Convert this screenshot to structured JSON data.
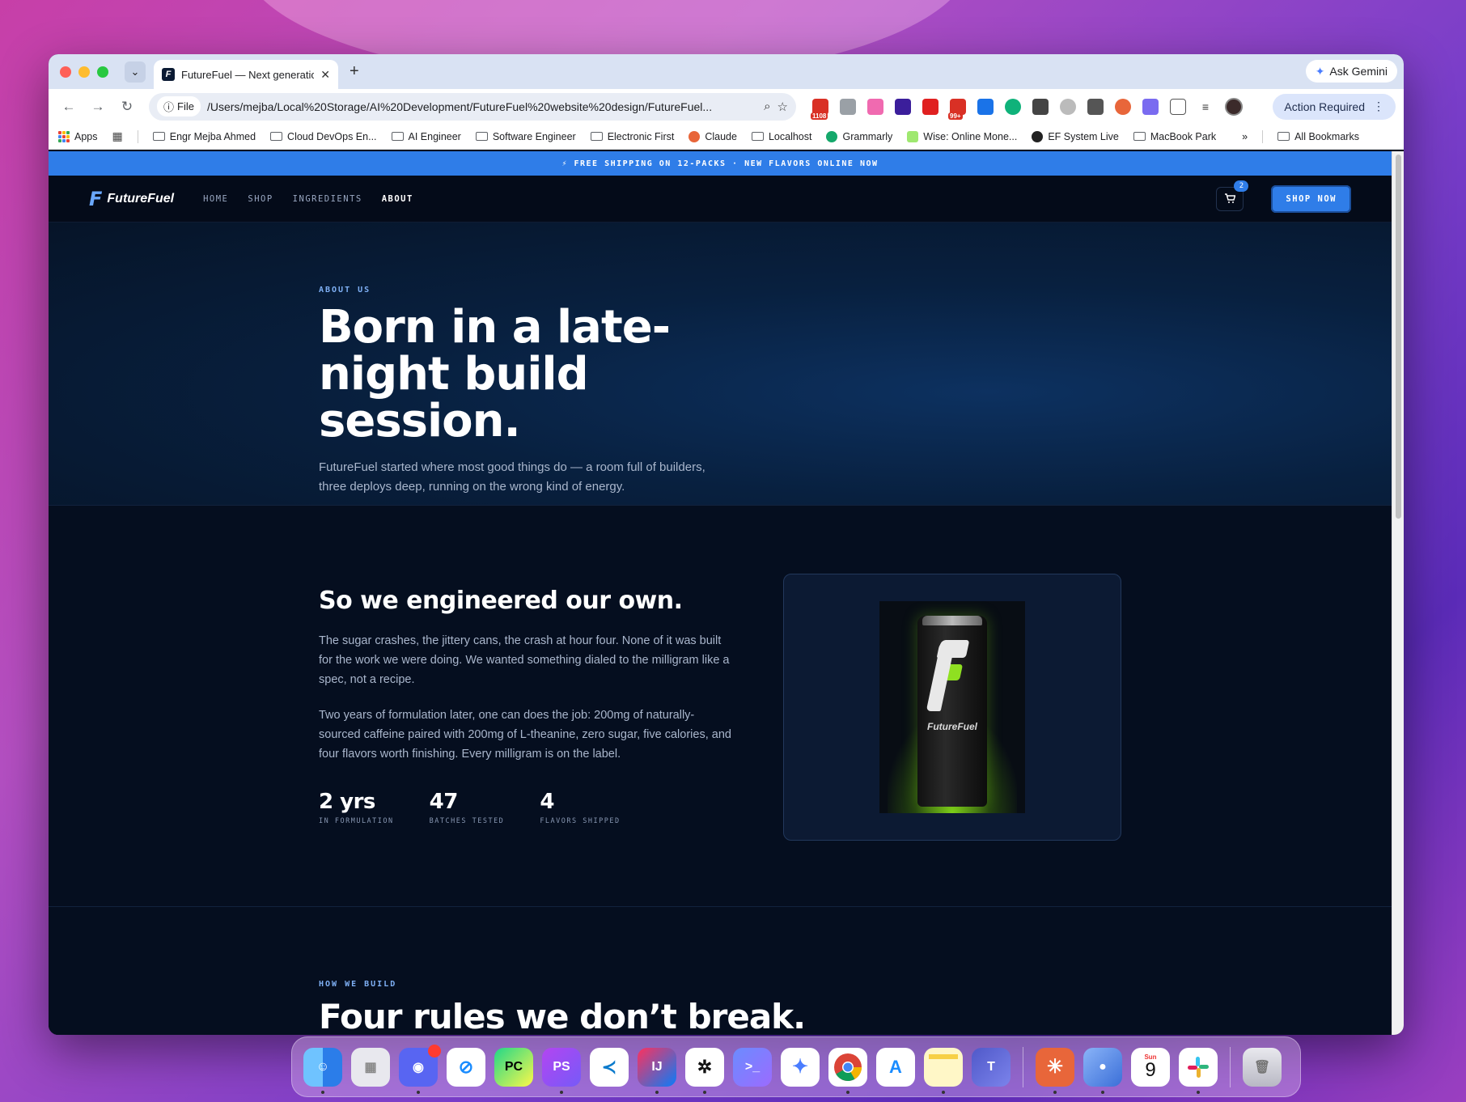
{
  "browser": {
    "tab_title": "FutureFuel — Next generation",
    "new_tab": "+",
    "ask_gemini": "Ask Gemini",
    "omnibox": {
      "scheme_label": "File",
      "url": "/Users/mejba/Local%20Storage/AI%20Development/FutureFuel%20website%20design/FutureFuel..."
    },
    "ext_badges": {
      "ext1": "1108",
      "ext2": "99+"
    },
    "action_required": "Action Required",
    "bookmarks": [
      "Apps",
      "Engr Mejba Ahmed",
      "Cloud DevOps En...",
      "AI Engineer",
      "Software Engineer",
      "Electronic First",
      "Claude",
      "Localhost",
      "Grammarly",
      "Wise: Online Mone...",
      "EF System Live",
      "MacBook Park",
      "All Bookmarks"
    ]
  },
  "site": {
    "promo": "⚡ FREE SHIPPING ON 12-PACKS · NEW FLAVORS ONLINE NOW",
    "logo_text": "FutureFuel",
    "nav": [
      "HOME",
      "SHOP",
      "INGREDIENTS",
      "ABOUT"
    ],
    "cart_count": "2",
    "shop_now": "SHOP NOW",
    "hero": {
      "eyebrow": "ABOUT US",
      "title": "Born in a late-night build session.",
      "subtitle": "FutureFuel started where most good things do — a room full of builders, three deploys deep, running on the wrong kind of energy."
    },
    "story": {
      "heading": "So we engineered our own.",
      "para1": "The sugar crashes, the jittery cans, the crash at hour four. None of it was built for the work we were doing. We wanted something dialed to the milligram like a spec, not a recipe.",
      "para2": "Two years of formulation later, one can does the job: 200mg of naturally-sourced caffeine paired with 200mg of L-theanine, zero sugar, five calories, and four flavors worth finishing. Every milligram is on the label.",
      "stats": [
        {
          "value": "2 yrs",
          "label": "IN FORMULATION"
        },
        {
          "value": "47",
          "label": "BATCHES TESTED"
        },
        {
          "value": "4",
          "label": "FLAVORS SHIPPED"
        }
      ],
      "can_label": "FutureFuel"
    },
    "rules": {
      "eyebrow": "HOW WE BUILD",
      "title": "Four rules we don’t break."
    }
  },
  "dock": {
    "calendar_month": "Sun",
    "calendar_day": "9",
    "apps": [
      "Finder",
      "Launchpad",
      "Discord",
      "Safari",
      "PyCharm",
      "PhpStorm",
      "VS Code",
      "IntelliJ IDEA",
      "Perplexity",
      "Terminal",
      "Gemini",
      "Chrome",
      "App Store",
      "Notes",
      "Teams",
      "Claude",
      "Docker",
      "Calendar",
      "Slack",
      "Trash"
    ]
  },
  "colors": {
    "accent": "#2f7de8",
    "page_bg": "#050e1f",
    "hero_bg": "#08203f",
    "can_glow": "#7fd11a"
  }
}
